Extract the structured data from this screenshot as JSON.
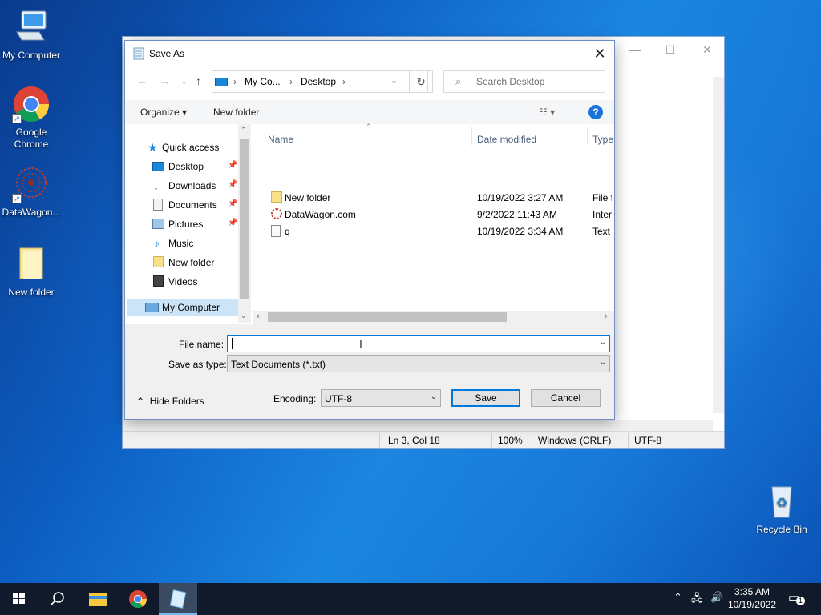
{
  "desktop": {
    "icons": [
      {
        "label": "My Computer"
      },
      {
        "label": "Google\nChrome"
      },
      {
        "label": "DataWagon..."
      },
      {
        "label": "New folder"
      },
      {
        "label": "Recycle Bin"
      }
    ]
  },
  "notepad": {
    "status": {
      "position": "Ln 3, Col 18",
      "zoom": "100%",
      "line_endings": "Windows (CRLF)",
      "encoding": "UTF-8"
    }
  },
  "dialog": {
    "title": "Save As",
    "address": {
      "root": "My Co...",
      "current": "Desktop"
    },
    "search_placeholder": "Search Desktop",
    "toolbar": {
      "organize": "Organize",
      "new_folder": "New folder"
    },
    "nav": {
      "quick_access": "Quick access",
      "items": [
        {
          "label": "Desktop"
        },
        {
          "label": "Downloads"
        },
        {
          "label": "Documents"
        },
        {
          "label": "Pictures"
        },
        {
          "label": "Music"
        },
        {
          "label": "New folder"
        },
        {
          "label": "Videos"
        }
      ],
      "my_computer": "My Computer"
    },
    "columns": {
      "name": "Name",
      "date": "Date modified",
      "type": "Type"
    },
    "files": [
      {
        "name": "New folder",
        "date": "10/19/2022 3:27 AM",
        "type": "File fo"
      },
      {
        "name": "DataWagon.com",
        "date": "9/2/2022 11:43 AM",
        "type": "Intern"
      },
      {
        "name": "q",
        "date": "10/19/2022 3:34 AM",
        "type": "Text D"
      }
    ],
    "file_name_label": "File name:",
    "file_name_value": "",
    "save_type_label": "Save as type:",
    "save_type_value": "Text Documents (*.txt)",
    "hide_folders": "Hide Folders",
    "encoding_label": "Encoding:",
    "encoding_value": "UTF-8",
    "save_button": "Save",
    "cancel_button": "Cancel"
  },
  "taskbar": {
    "clock_time": "3:35 AM",
    "clock_date": "10/19/2022",
    "notification_count": "1"
  },
  "colors": {
    "accent": "#0078d7",
    "selection": "#cce4f7",
    "help": "#1a73d9"
  }
}
